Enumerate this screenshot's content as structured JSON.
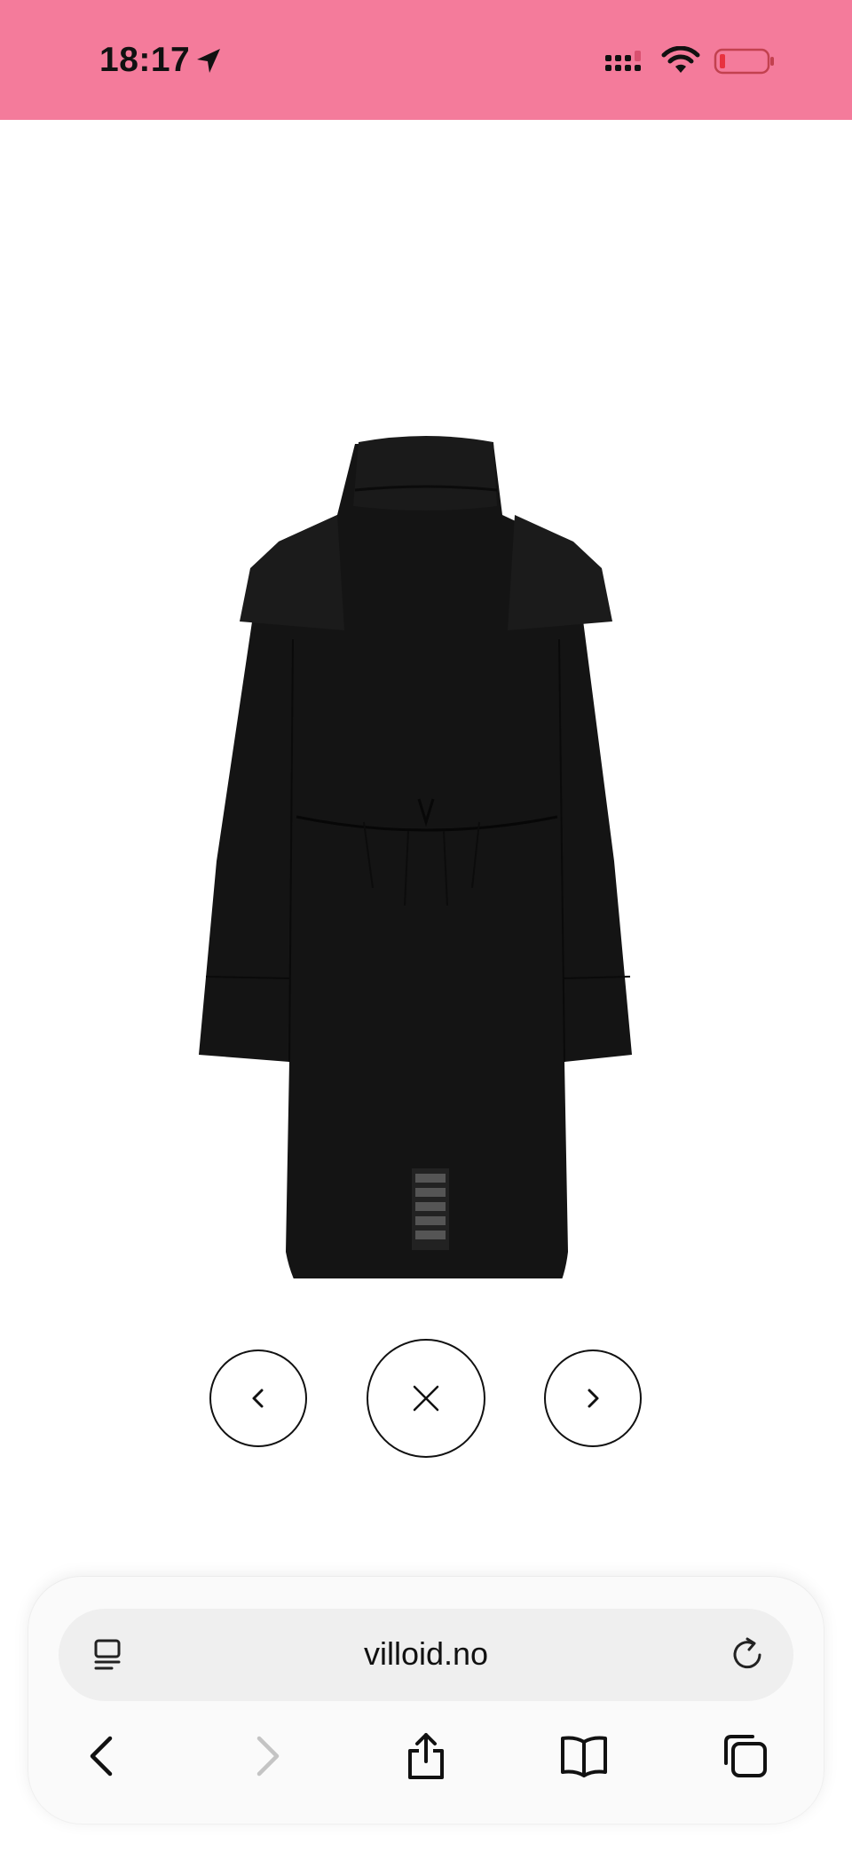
{
  "status_bar": {
    "time": "18:17",
    "background": "#f47b9b",
    "icons": [
      "location-arrow-icon",
      "cellular-signal-icon",
      "wifi-icon",
      "battery-low-icon"
    ]
  },
  "product": {
    "image": "black-jacket-back-view"
  },
  "gallery_controls": {
    "prev_icon": "chevron-left-icon",
    "close_icon": "close-icon",
    "next_icon": "chevron-right-icon"
  },
  "browser": {
    "url": "villoid.no",
    "icons": [
      "reader-mode-icon",
      "reload-icon",
      "back-icon",
      "forward-icon",
      "share-icon",
      "bookmarks-icon",
      "tabs-icon"
    ]
  }
}
